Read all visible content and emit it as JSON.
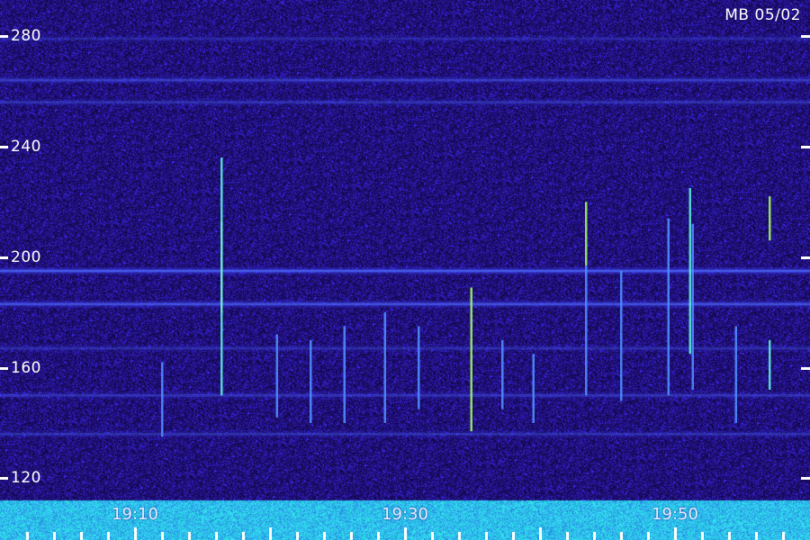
{
  "title": "MB 05/02",
  "chart_data": {
    "type": "heatmap",
    "title": "MB 05/02",
    "y_ticks": [
      "280",
      "240",
      "200",
      "160",
      "120"
    ],
    "y_tick_values": [
      280,
      240,
      200,
      160,
      120
    ],
    "ylim": [
      112,
      293
    ],
    "x_labels": [
      "19:10",
      "19:30",
      "19:50"
    ],
    "x_range_minutes": [
      1140,
      1200
    ],
    "x_label_minutes": [
      1150,
      1170,
      1190
    ],
    "x_minor_step_minutes": 2,
    "colormap": [
      "#1c0a5c",
      "#2a14a0",
      "#3450e0",
      "#4aa0ff",
      "#58e0e0",
      "#a8f060",
      "#f0e050",
      "#ff6030"
    ],
    "continuous_bands": [
      {
        "y": 195,
        "intensity": 0.95
      },
      {
        "y": 183,
        "intensity": 0.8
      },
      {
        "y": 264,
        "intensity": 0.55
      },
      {
        "y": 256,
        "intensity": 0.4
      },
      {
        "y": 279,
        "intensity": 0.3
      },
      {
        "y": 150,
        "intensity": 0.45
      },
      {
        "y": 136,
        "intensity": 0.4
      },
      {
        "y": 167,
        "intensity": 0.35
      }
    ],
    "vertical_bursts": [
      {
        "t": 1156.4,
        "y_from": 180,
        "y_to": 213,
        "intensity": 1.0
      },
      {
        "t": 1156.4,
        "y_from": 150,
        "y_to": 236,
        "intensity": 0.55
      },
      {
        "t": 1174.9,
        "y_from": 137,
        "y_to": 189,
        "intensity": 0.75
      },
      {
        "t": 1183.4,
        "y_from": 197,
        "y_to": 220,
        "intensity": 0.8
      },
      {
        "t": 1183.4,
        "y_from": 150,
        "y_to": 197,
        "intensity": 0.4
      },
      {
        "t": 1191.1,
        "y_from": 165,
        "y_to": 225,
        "intensity": 0.7
      },
      {
        "t": 1191.3,
        "y_from": 152,
        "y_to": 212,
        "intensity": 0.5
      },
      {
        "t": 1186.0,
        "y_from": 148,
        "y_to": 195,
        "intensity": 0.45
      },
      {
        "t": 1197.0,
        "y_from": 206,
        "y_to": 222,
        "intensity": 0.9
      },
      {
        "t": 1197.0,
        "y_from": 152,
        "y_to": 170,
        "intensity": 0.6
      },
      {
        "t": 1189.5,
        "y_from": 150,
        "y_to": 214,
        "intensity": 0.45
      },
      {
        "t": 1165.5,
        "y_from": 140,
        "y_to": 175,
        "intensity": 0.45
      },
      {
        "t": 1163.0,
        "y_from": 140,
        "y_to": 170,
        "intensity": 0.4
      },
      {
        "t": 1177.2,
        "y_from": 145,
        "y_to": 170,
        "intensity": 0.4
      },
      {
        "t": 1160.5,
        "y_from": 142,
        "y_to": 172,
        "intensity": 0.35
      },
      {
        "t": 1168.5,
        "y_from": 140,
        "y_to": 180,
        "intensity": 0.35
      },
      {
        "t": 1152.0,
        "y_from": 135,
        "y_to": 162,
        "intensity": 0.35
      },
      {
        "t": 1171.0,
        "y_from": 145,
        "y_to": 175,
        "intensity": 0.3
      },
      {
        "t": 1179.5,
        "y_from": 140,
        "y_to": 165,
        "intensity": 0.35
      },
      {
        "t": 1194.5,
        "y_from": 140,
        "y_to": 175,
        "intensity": 0.3
      }
    ]
  }
}
